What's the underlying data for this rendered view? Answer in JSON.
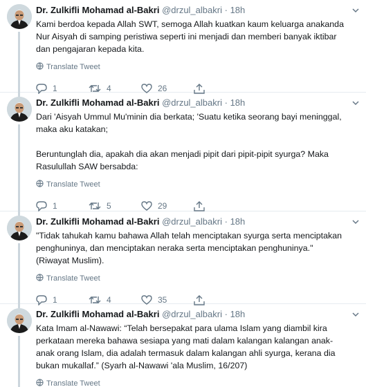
{
  "tweets": [
    {
      "author": "Dr. Zulkifli Mohamad al-Bakri",
      "handle": "@drzul_albakri",
      "separator": "·",
      "time": "18h",
      "text": "Kami berdoa kepada Allah SWT, semoga Allah kuatkan kaum keluarga anakanda\nNur Aisyah di samping peristiwa seperti ini menjadi dan memberi banyak iktibar\ndan pengajaran kepada kita.",
      "translate_label": "Translate Tweet",
      "replies": "1",
      "retweets": "4",
      "likes": "26"
    },
    {
      "author": "Dr. Zulkifli Mohamad al-Bakri",
      "handle": "@drzul_albakri",
      "separator": "·",
      "time": "18h",
      "text": "Dari 'Aisyah Ummul Mu'minin dia berkata; 'Suatu ketika seorang bayi meninggal,\nmaka aku katakan;\n\nBeruntunglah dia, apakah dia akan menjadi pipit dari pipit-pipit syurga? Maka\nRasulullah SAW bersabda:",
      "translate_label": "Translate Tweet",
      "replies": "1",
      "retweets": "5",
      "likes": "29"
    },
    {
      "author": "Dr. Zulkifli Mohamad al-Bakri",
      "handle": "@drzul_albakri",
      "separator": "·",
      "time": "18h",
      "text": "\"Tidak tahukah kamu bahawa Allah telah menciptakan syurga serta menciptakan\npenghuninya, dan menciptakan neraka serta menciptakan penghuninya.\"\n(Riwayat Muslim).",
      "translate_label": "Translate Tweet",
      "replies": "1",
      "retweets": "4",
      "likes": "35"
    },
    {
      "author": "Dr. Zulkifli Mohamad al-Bakri",
      "handle": "@drzul_albakri",
      "separator": "·",
      "time": "18h",
      "text": "Kata Imam al-Nawawi: “Telah bersepakat para ulama Islam yang diambil kira\nperkataan mereka bahawa sesiapa yang mati dalam kalangan kalangan anak-\nanak orang Islam, dia adalah termasuk dalam kalangan ahli syurga, kerana dia\nbukan mukallaf.” (Syarh al-Nawawi 'ala Muslim, 16/207)",
      "translate_label": "Translate Tweet"
    }
  ],
  "colors": {
    "text": "#14171a",
    "muted": "#657786",
    "thread_line": "#ccd6dd",
    "divider": "#e6ecf0"
  },
  "icons": {
    "reply": "reply-icon",
    "retweet": "retweet-icon",
    "like": "heart-icon",
    "translate": "globe-icon",
    "caret": "chevron-down-icon"
  }
}
